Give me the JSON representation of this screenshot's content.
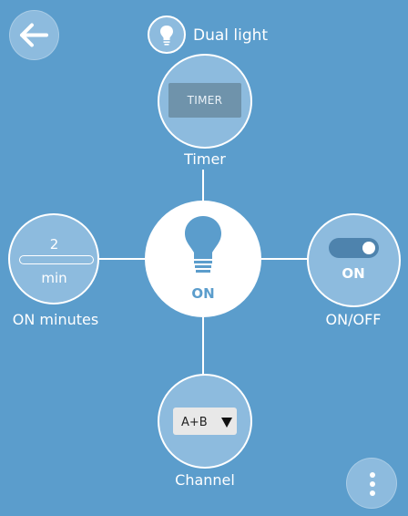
{
  "header": {
    "title": "Dual light",
    "icon": "lightbulb-icon"
  },
  "navigation": {
    "back_icon": "arrow-left-icon",
    "menu_icon": "more-vertical-icon"
  },
  "device": {
    "state": "ON",
    "icon": "lightbulb-icon"
  },
  "timer": {
    "button_label": "TIMER",
    "caption": "Timer"
  },
  "on_minutes": {
    "value": "2",
    "unit": "min",
    "caption": "ON minutes"
  },
  "on_off": {
    "state_label": "ON",
    "caption": "ON/OFF",
    "checked": true
  },
  "channel": {
    "selected": "A+B",
    "caption": "Channel"
  },
  "colors": {
    "background": "#5b9dcc",
    "node": "#8dbbde",
    "accent": "#ffffff"
  }
}
